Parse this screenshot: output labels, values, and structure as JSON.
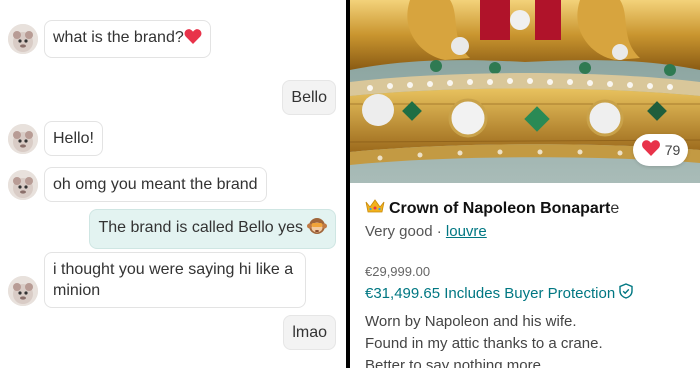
{
  "chat": {
    "messages": [
      {
        "from": "them",
        "text": "what is the brand?"
      },
      {
        "from": "me",
        "text": "Bello"
      },
      {
        "from": "them",
        "text": "Hello!"
      },
      {
        "from": "them",
        "text": "oh omg you meant the brand"
      },
      {
        "from": "me",
        "text": "The brand is called Bello yes"
      },
      {
        "from": "them",
        "text": "i thought you were saying hi like a minion"
      },
      {
        "from": "me",
        "text": "lmao"
      }
    ]
  },
  "listing": {
    "favorites_count": "79",
    "title": "Crown of Napoleon Bonapart",
    "title_tail": "e",
    "condition": "Very good",
    "separator": "·",
    "brand": "louvre",
    "price": "€29,999.00",
    "price_with_protection": "€31,499.65 Includes Buyer Protection",
    "description": [
      "Worn by Napoleon and his wife.",
      "Found in my attic thanks to a crane.",
      "Better to say nothing more..."
    ]
  },
  "colors": {
    "accent": "#007782",
    "heart": "#e8334a",
    "divider": "#000000"
  },
  "icons": [
    "heart-emoji",
    "monkey-emoji",
    "crown-emoji",
    "heart-icon",
    "shield-check-icon",
    "avatar"
  ]
}
